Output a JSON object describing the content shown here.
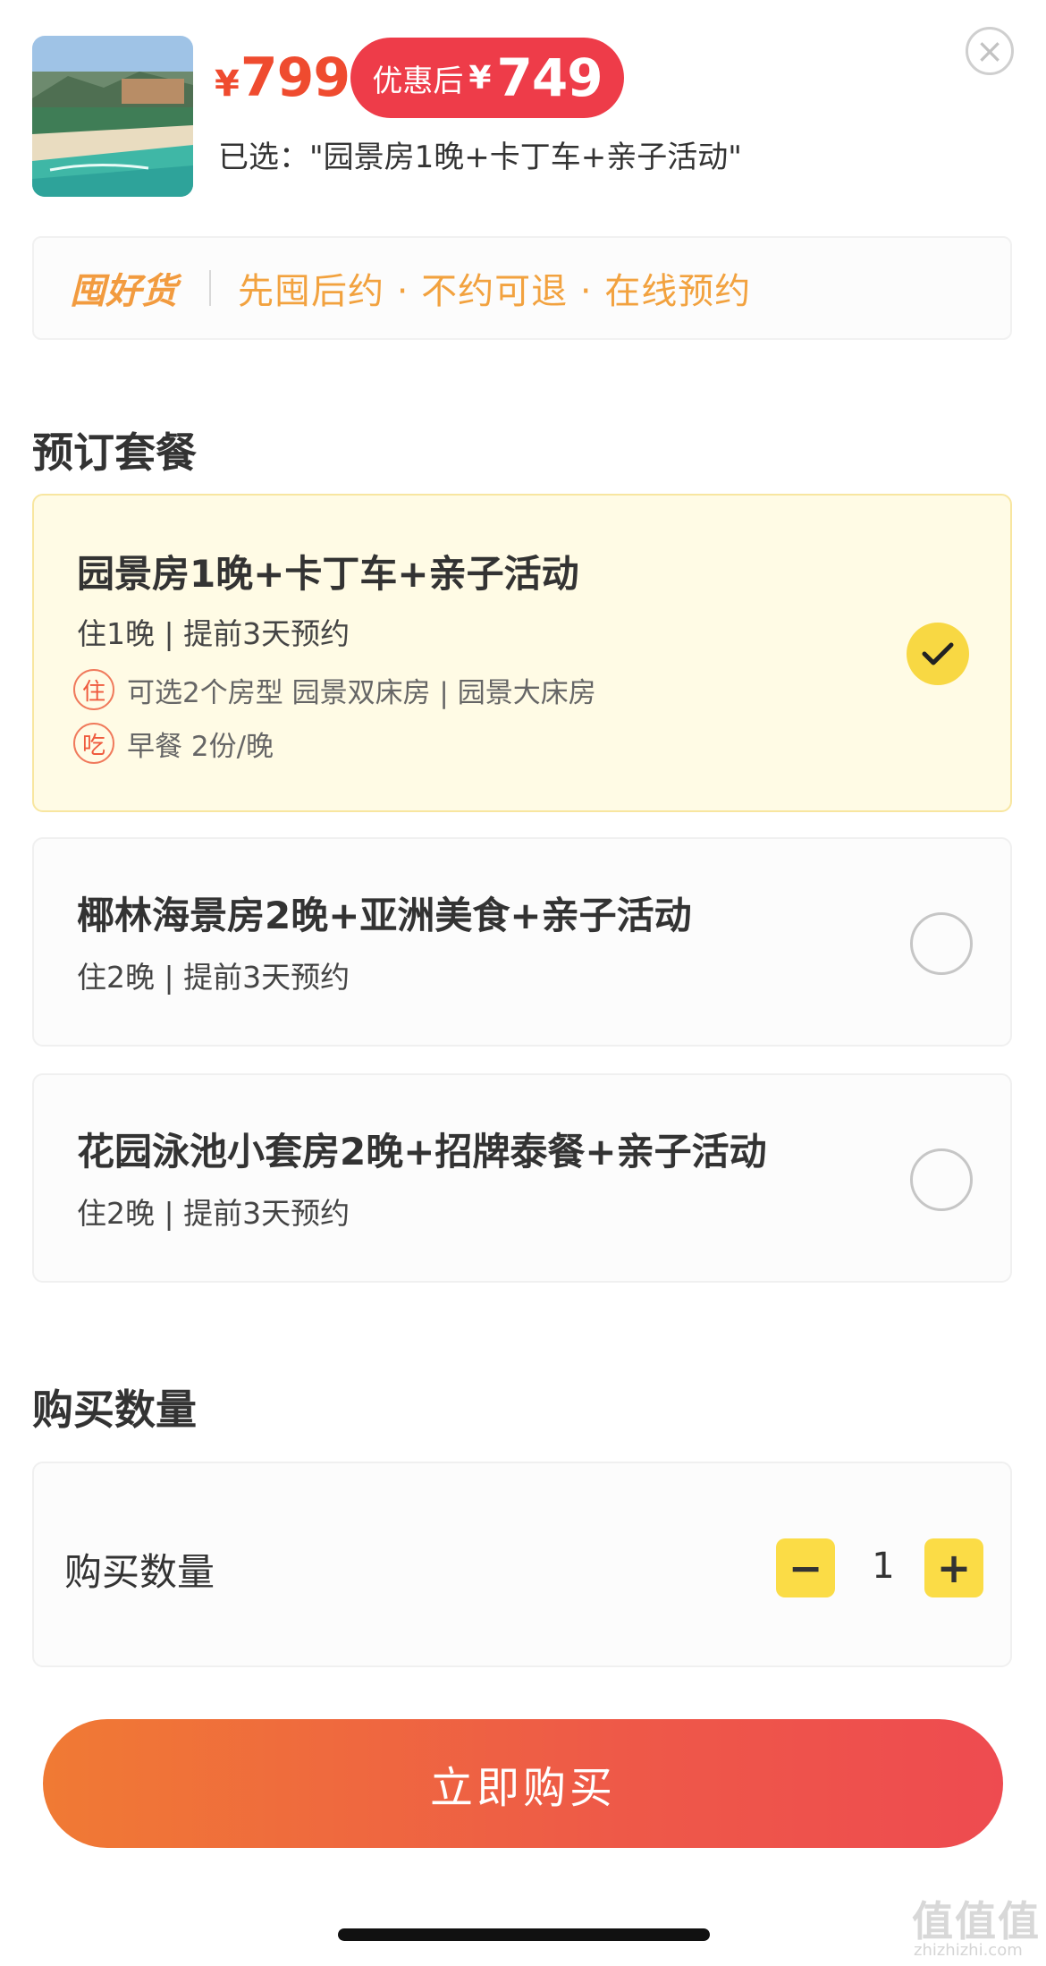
{
  "header": {
    "price_currency": "¥",
    "price": "799",
    "promo_label": "优惠后",
    "promo_currency": "¥",
    "promo_price": "749",
    "selected_text": "已选：\"园景房1晚+卡丁车+亲子活动\"",
    "close_glyph": "×"
  },
  "banner": {
    "logo": "囤好货",
    "slogan": "先囤后约 · 不约可退 · 在线预约"
  },
  "packages_section": {
    "title": "预订套餐",
    "items": [
      {
        "title": "园景房1晚+卡丁车+亲子活动",
        "meta": "住1晚 | 提前3天预约",
        "selected": true,
        "details": [
          {
            "tag": "住",
            "text": "可选2个房型 园景双床房 | 园景大床房"
          },
          {
            "tag": "吃",
            "text": "早餐  2份/晚"
          }
        ]
      },
      {
        "title": "椰林海景房2晚+亚洲美食+亲子活动",
        "meta": "住2晚 | 提前3天预约",
        "selected": false
      },
      {
        "title": "花园泳池小套房2晚+招牌泰餐+亲子活动",
        "meta": "住2晚 | 提前3天预约",
        "selected": false
      }
    ]
  },
  "quantity_section": {
    "title": "购买数量",
    "label": "购买数量",
    "value": "1",
    "minus": "−",
    "plus": "+"
  },
  "buy_button": {
    "label": "立即购买"
  },
  "watermark": {
    "text": "值值值",
    "sub": "zhizhizhi.com"
  },
  "colors": {
    "price": "#ef4b2f",
    "promo_bg": "#ee3c49",
    "selected_bg": "#fffbe5",
    "check_yellow": "#f8d843",
    "stepper_yellow": "#fbdc46",
    "buy_gradient_start": "#f07a34",
    "buy_gradient_end": "#ee4b50"
  }
}
